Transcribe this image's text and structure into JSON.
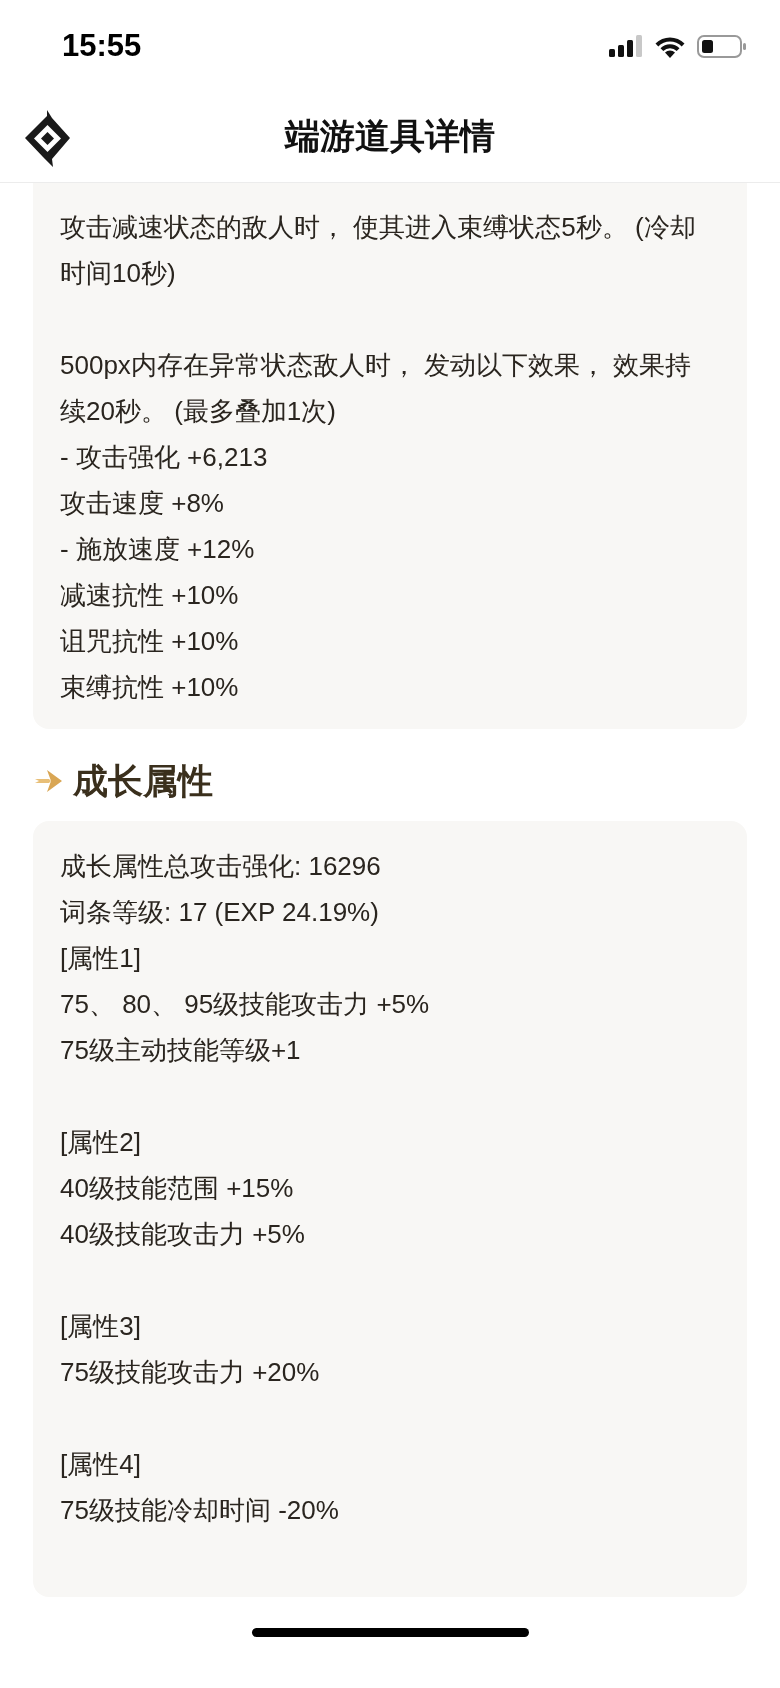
{
  "status_bar": {
    "time": "15:55"
  },
  "header": {
    "title": "端游道具详情"
  },
  "effect_card": {
    "paragraphs": [
      [
        "攻击减速状态的敌人时， 使其进入束缚状态5秒。 (冷却时间10秒)"
      ],
      [
        "500px内存在异常状态敌人时， 发动以下效果， 效果持续20秒。 (最多叠加1次)",
        "- 攻击强化 +6,213",
        "攻击速度 +8%",
        "- 施放速度 +12%",
        "减速抗性 +10%",
        "诅咒抗性 +10%",
        "束缚抗性 +10%"
      ]
    ]
  },
  "growth_section": {
    "title": "成长属性",
    "paragraphs": [
      [
        "成长属性总攻击强化: 16296",
        "词条等级: 17 (EXP 24.19%)",
        "[属性1]",
        "75、 80、 95级技能攻击力 +5%",
        "75级主动技能等级+1"
      ],
      [
        "[属性2]",
        "40级技能范围 +15%",
        "40级技能攻击力 +5%"
      ],
      [
        "[属性3]",
        "75级技能攻击力 +20%"
      ],
      [
        "[属性4]",
        "75级技能冷却时间 -20%"
      ]
    ]
  }
}
